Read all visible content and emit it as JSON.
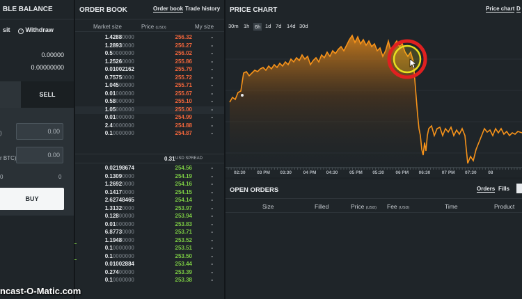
{
  "left": {
    "title": "BLE BALANCE",
    "deposit": "sit",
    "withdraw": "Withdraw",
    "balance_1": "0.00000",
    "balance_2": "0.00000000",
    "tab_sell": "SELL",
    "field_1_value": "0.00",
    "field_2_label": "r BTC)",
    "field_2_value": "0.00",
    "total_label": "0",
    "total_value": "0",
    "buy_label": "BUY"
  },
  "orderbook": {
    "title": "ORDER BOOK",
    "tab_orderbook": "Order book",
    "tab_trade_history": "Trade history",
    "col_market_size": "Market size",
    "col_price": "Price",
    "col_price_unit": "(USD)",
    "col_my_size": "My size",
    "asks": [
      {
        "size": "1.4288",
        "pad": "0000",
        "price": "256.32",
        "my": "-"
      },
      {
        "size": "1.2893",
        "pad": "0000",
        "price": "256.27",
        "my": "-"
      },
      {
        "size": "0.5",
        "pad": "0000000",
        "price": "256.02",
        "my": "-"
      },
      {
        "size": "1.2526",
        "pad": "0000",
        "price": "255.86",
        "my": "-"
      },
      {
        "size": "0.01002162",
        "pad": "",
        "price": "255.79",
        "my": "-"
      },
      {
        "size": "0.7575",
        "pad": "0000",
        "price": "255.72",
        "my": "-"
      },
      {
        "size": "1.045",
        "pad": "00000",
        "price": "255.71",
        "my": "-"
      },
      {
        "size": "0.01",
        "pad": "000000",
        "price": "255.67",
        "my": "-"
      },
      {
        "size": "0.58",
        "pad": "000000",
        "price": "255.10",
        "my": "-"
      },
      {
        "size": "1.05",
        "pad": "000000",
        "price": "255.00",
        "my": "-"
      },
      {
        "size": "0.01",
        "pad": "000000",
        "price": "254.99",
        "my": "-"
      },
      {
        "size": "2.4",
        "pad": "0000000",
        "price": "254.88",
        "my": "-"
      },
      {
        "size": "0.1",
        "pad": "0000000",
        "price": "254.87",
        "my": "-"
      }
    ],
    "spread_value": "0.31",
    "spread_label": "USD SPREAD",
    "bids": [
      {
        "size": "0.02198674",
        "pad": "",
        "price": "254.56",
        "my": "-"
      },
      {
        "size": "0.1309",
        "pad": "0000",
        "price": "254.19",
        "my": "-"
      },
      {
        "size": "1.2692",
        "pad": "0000",
        "price": "254.16",
        "my": "-"
      },
      {
        "size": "0.1417",
        "pad": "0000",
        "price": "254.15",
        "my": "-"
      },
      {
        "size": "2.62748465",
        "pad": "",
        "price": "254.14",
        "my": "-"
      },
      {
        "size": "1.3132",
        "pad": "0000",
        "price": "253.97",
        "my": "-"
      },
      {
        "size": "0.128",
        "pad": "00000",
        "price": "253.94",
        "my": "-"
      },
      {
        "size": "0.01",
        "pad": "000000",
        "price": "253.83",
        "my": "-"
      },
      {
        "size": "6.8773",
        "pad": "0000",
        "price": "253.71",
        "my": "-"
      },
      {
        "size": "1.1948",
        "pad": "0000",
        "price": "253.52",
        "my": "-"
      },
      {
        "size": "0.1",
        "pad": "0000000",
        "price": "253.51",
        "my": "-"
      },
      {
        "size": "0.1",
        "pad": "0000000",
        "price": "253.50",
        "my": "-"
      },
      {
        "size": "0.01002884",
        "pad": "",
        "price": "253.44",
        "my": "-"
      },
      {
        "size": "0.274",
        "pad": "00000",
        "price": "253.39",
        "my": "-"
      },
      {
        "size": "0.1",
        "pad": "0000000",
        "price": "253.38",
        "my": "-"
      }
    ]
  },
  "price_chart": {
    "title": "PRICE CHART",
    "tab_price_chart": "Price chart",
    "tab_depth": "D",
    "timeframes": [
      "30m",
      "1h",
      "6h",
      "1d",
      "7d",
      "14d",
      "30d"
    ],
    "active_timeframe": "6h",
    "x_labels": [
      "02:30",
      "03 PM",
      "03:30",
      "04 PM",
      "04:30",
      "05 PM",
      "05:30",
      "06 PM",
      "06:30",
      "07 PM",
      "07:30",
      "08"
    ],
    "colors": {
      "line": "#f7931a",
      "highlight_outer": "#e02020",
      "highlight_inner": "#e8e020"
    }
  },
  "open_orders": {
    "title": "OPEN ORDERS",
    "tab_orders": "Orders",
    "tab_fills": "Fills",
    "columns": [
      {
        "label": "Size",
        "unit": ""
      },
      {
        "label": "Filled",
        "unit": ""
      },
      {
        "label": "Price",
        "unit": "(USD)"
      },
      {
        "label": "Fee",
        "unit": "(USD)"
      },
      {
        "label": "Time",
        "unit": ""
      },
      {
        "label": "Product",
        "unit": ""
      }
    ]
  },
  "watermark": "ncast-O-Matic.com"
}
